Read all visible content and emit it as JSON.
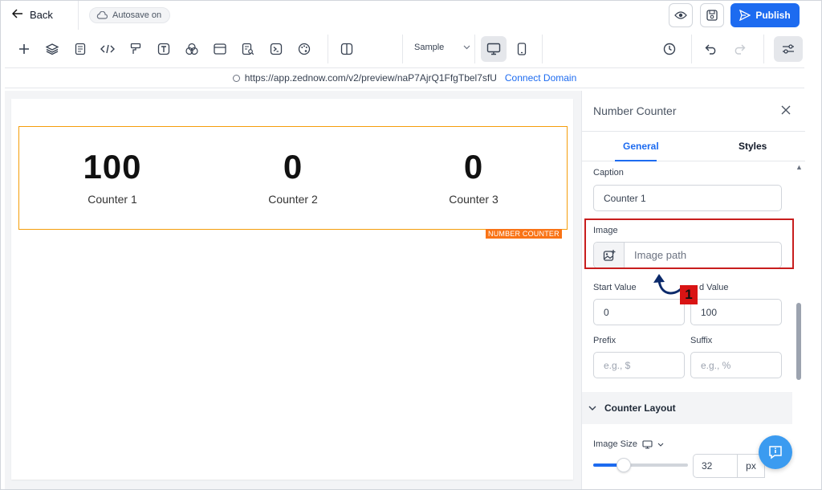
{
  "topbar": {
    "back_label": "Back",
    "autosave_label": "Autosave on",
    "publish_label": "Publish"
  },
  "toolbar": {
    "page_select": "Sample"
  },
  "urlbar": {
    "url": "https://app.zednow.com/v2/preview/naP7AjrQ1FfgTbel7sfU",
    "connect_label": "Connect Domain"
  },
  "canvas": {
    "counters": [
      {
        "value": "100",
        "caption": "Counter 1"
      },
      {
        "value": "0",
        "caption": "Counter 2"
      },
      {
        "value": "0",
        "caption": "Counter 3"
      }
    ],
    "component_tag": "NUMBER COUNTER"
  },
  "panel": {
    "title": "Number Counter",
    "tabs": [
      "General",
      "Styles"
    ],
    "caption_label": "Caption",
    "caption_value": "Counter 1",
    "image_label": "Image",
    "image_placeholder": "Image path",
    "start_label": "Start Value",
    "start_value": "0",
    "end_label": "End Value",
    "end_label_visible": "d Value",
    "end_value": "100",
    "prefix_label": "Prefix",
    "prefix_placeholder": "e.g., $",
    "suffix_label": "Suffix",
    "suffix_placeholder": "e.g., %",
    "section_label": "Counter Layout",
    "image_size_label": "Image Size",
    "image_size_value": "32",
    "image_size_unit": "px",
    "image_size_slider": 0.32
  },
  "annotation": {
    "step_number": "1"
  },
  "colors": {
    "accent": "#1d6bf0",
    "highlight": "#c81e1e",
    "component_border": "#f59e0b"
  }
}
